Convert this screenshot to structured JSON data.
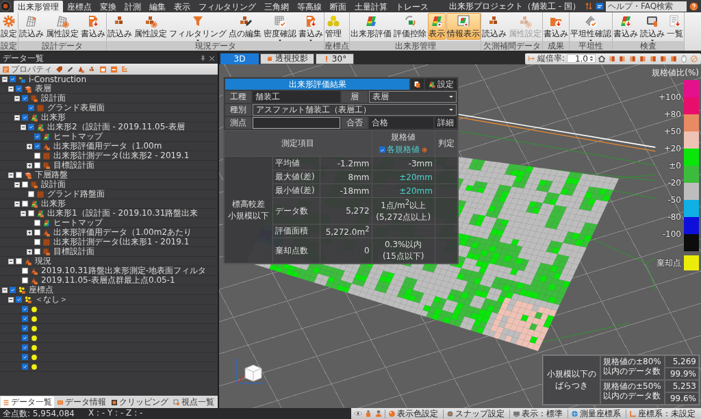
{
  "menu_tabs": [
    {
      "label": "出来形管理",
      "selected": true
    },
    {
      "label": "座標点",
      "selected": false
    },
    {
      "label": "変換",
      "selected": false
    },
    {
      "label": "計測",
      "selected": false
    },
    {
      "label": "編集",
      "selected": false
    },
    {
      "label": "表示",
      "selected": false
    },
    {
      "label": "フィルタリング",
      "selected": false
    },
    {
      "label": "三角網",
      "selected": false
    },
    {
      "label": "等高線",
      "selected": false
    },
    {
      "label": "断面",
      "selected": false
    },
    {
      "label": "土量計算",
      "selected": false
    },
    {
      "label": "トレース",
      "selected": false
    }
  ],
  "project_title": "出来形プロジェクト（舗装工 - 国）",
  "help_search": {
    "placeholder": "ヘルプ・FAQ検索"
  },
  "ribbon_groups": [
    {
      "label": "設定",
      "buttons": [
        {
          "label": "設定",
          "active": false,
          "disabled": false,
          "dropdown": false
        }
      ]
    },
    {
      "label": "設計データ",
      "buttons": [
        {
          "label": "読込み",
          "active": false,
          "disabled": false,
          "dropdown": false
        },
        {
          "label": "属性設定",
          "active": false,
          "disabled": false,
          "dropdown": false
        },
        {
          "label": "書込み",
          "active": false,
          "disabled": false,
          "dropdown": false
        }
      ]
    },
    {
      "label": "現況データ",
      "buttons": [
        {
          "label": "読込み",
          "active": false,
          "disabled": false,
          "dropdown": false
        },
        {
          "label": "属性設定",
          "active": false,
          "disabled": false,
          "dropdown": false
        },
        {
          "label": "フィルタリング",
          "active": false,
          "disabled": false,
          "dropdown": true
        },
        {
          "label": "点の編集",
          "active": false,
          "disabled": false,
          "dropdown": false
        },
        {
          "label": "密度確認",
          "active": false,
          "disabled": false,
          "dropdown": true
        },
        {
          "label": "書込み",
          "active": false,
          "disabled": false,
          "dropdown": true
        }
      ]
    },
    {
      "label": "座標点",
      "buttons": [
        {
          "label": "管理",
          "active": false,
          "disabled": false,
          "dropdown": false
        }
      ]
    },
    {
      "label": "出来形管理",
      "buttons": [
        {
          "label": "出来形評価",
          "active": false,
          "disabled": false,
          "dropdown": false
        },
        {
          "label": "評価控除",
          "active": false,
          "disabled": false,
          "dropdown": false
        },
        {
          "label": "表示",
          "active": true,
          "disabled": false,
          "dropdown": false
        },
        {
          "label": "情報表示",
          "active": true,
          "disabled": false,
          "dropdown": false
        }
      ]
    },
    {
      "label": "欠測補間データ",
      "buttons": [
        {
          "label": "読込み",
          "active": false,
          "disabled": false,
          "dropdown": false
        },
        {
          "label": "属性設定",
          "active": false,
          "disabled": true,
          "dropdown": false
        }
      ]
    },
    {
      "label": "成果",
      "buttons": [
        {
          "label": "書込み",
          "active": false,
          "disabled": false,
          "dropdown": false
        }
      ]
    },
    {
      "label": "平坦性",
      "buttons": [
        {
          "label": "平坦性確認",
          "active": false,
          "disabled": false,
          "dropdown": true
        }
      ]
    },
    {
      "label": "検査",
      "buttons": [
        {
          "label": "書込み",
          "active": false,
          "disabled": false,
          "dropdown": false
        },
        {
          "label": "読込み",
          "active": false,
          "disabled": false,
          "dropdown": true
        },
        {
          "label": "一覧",
          "active": false,
          "disabled": false,
          "dropdown": false
        }
      ]
    }
  ],
  "data_panel": {
    "title": "データ一覧",
    "toolbar_label": "プロパティ",
    "tree": [
      {
        "label": "i-Construction",
        "kind": "project",
        "checked": true,
        "expanded": true,
        "children": [
          {
            "label": "表層",
            "kind": "layer",
            "checked": true,
            "expanded": true,
            "children": [
              {
                "label": "設計面",
                "kind": "design",
                "checked": true,
                "expanded": true,
                "children": [
                  {
                    "label": "グランド表層面",
                    "kind": "surface",
                    "checked": true
                  }
                ]
              },
              {
                "label": "出来形",
                "kind": "finish",
                "checked": true,
                "expanded": true,
                "children": [
                  {
                    "label": "出来形2（設計面 - 2019.11.05-表層",
                    "kind": "finish",
                    "checked": true,
                    "expanded": true,
                    "children": [
                      {
                        "label": "ヒートマップ",
                        "kind": "heatmap",
                        "checked": true
                      },
                      {
                        "label": "出来形評価用データ（1.00m",
                        "kind": "cone",
                        "checked": true,
                        "expanded": false
                      },
                      {
                        "label": "出来形計測データ(出来形2 - 2019.1",
                        "kind": "surface",
                        "checked": false
                      },
                      {
                        "label": "目標設計面",
                        "kind": "design",
                        "checked": false,
                        "expanded": false
                      }
                    ]
                  }
                ]
              }
            ]
          },
          {
            "label": "下層路盤",
            "kind": "layer",
            "checked": false,
            "expanded": true,
            "children": [
              {
                "label": "設計面",
                "kind": "design",
                "checked": false,
                "expanded": true,
                "children": [
                  {
                    "label": "グランド路盤面",
                    "kind": "surface",
                    "checked": false
                  }
                ]
              },
              {
                "label": "出来形",
                "kind": "finish",
                "checked": false,
                "expanded": true,
                "children": [
                  {
                    "label": "出来形1（設計面 - 2019.10.31路盤出来",
                    "kind": "finish",
                    "checked": false,
                    "expanded": true,
                    "children": [
                      {
                        "label": "ヒートマップ",
                        "kind": "heatmap",
                        "checked": false
                      },
                      {
                        "label": "出来形評価用データ（1.00m2あたり",
                        "kind": "cone",
                        "checked": false,
                        "expanded": false
                      },
                      {
                        "label": "出来形計測データ(出来形1 - 2019.1",
                        "kind": "surface",
                        "checked": false
                      },
                      {
                        "label": "目標設計面",
                        "kind": "design",
                        "checked": false,
                        "expanded": false
                      }
                    ]
                  }
                ]
              }
            ]
          },
          {
            "label": "現況",
            "kind": "cone",
            "checked": false,
            "expanded": true,
            "children": [
              {
                "label": "2019.10.31路盤出来形測定-地表面フィルタ",
                "kind": "cone",
                "checked": false
              },
              {
                "label": "2019.11.05-表層点群最上点0.05-1",
                "kind": "cone",
                "checked": false
              }
            ]
          }
        ]
      },
      {
        "label": "座標点",
        "kind": "points",
        "checked": true,
        "expanded": true,
        "children": [
          {
            "label": "＜なし＞",
            "kind": "points",
            "checked": true,
            "expanded": true,
            "children": [
              {
                "kind": "point",
                "checked": true
              },
              {
                "kind": "point",
                "checked": true
              },
              {
                "kind": "point",
                "checked": true
              },
              {
                "kind": "point",
                "checked": true
              },
              {
                "kind": "point",
                "checked": true
              },
              {
                "kind": "point",
                "checked": true
              },
              {
                "kind": "point",
                "checked": true
              }
            ]
          }
        ]
      }
    ],
    "tabs": [
      {
        "label": "データ一覧",
        "selected": true
      },
      {
        "label": "データ情報",
        "selected": false
      },
      {
        "label": "クリッピング",
        "selected": false
      },
      {
        "label": "視点一覧",
        "selected": false
      }
    ]
  },
  "view": {
    "tabs": [
      {
        "label": "3D",
        "selected": true
      },
      {
        "label": "透視投影",
        "selected": false
      },
      {
        "label": "30°",
        "selected": false
      }
    ],
    "scale_label": "縦倍率:",
    "scale_value": "1.0",
    "legend": {
      "title": "規格値比(%)",
      "bands": [
        {
          "color": "#e4108c"
        },
        {
          "label": "+100",
          "color": "#e80f6c"
        },
        {
          "label": "+80",
          "color": "#e88a62"
        },
        {
          "label": "+50",
          "color": "#efc2b6"
        },
        {
          "label": "+20",
          "color": "#0ae60a"
        },
        {
          "label": "±0",
          "color": "#3cbc3c"
        },
        {
          "label": "-20",
          "color": "#bdbdbd"
        },
        {
          "label": "-50",
          "color": "#0eb0e6"
        },
        {
          "label": "-80",
          "color": "#0f0fdc"
        },
        {
          "label": "-100",
          "color": "#0c0c0c"
        }
      ],
      "rejected": {
        "label": "棄却点",
        "color": "#ecec0a"
      }
    },
    "eval_panel": {
      "title": "出来形評価結果",
      "settings_button": "設定",
      "work_type": {
        "label": "工種",
        "value": "舗装工"
      },
      "layer": {
        "label": "層",
        "value": "表層"
      },
      "category": {
        "label": "種別",
        "value": "アスファルト舗装工（表層工）"
      },
      "station": {
        "label": "測点"
      },
      "result": {
        "label": "合否",
        "value": "合格"
      },
      "detail_button": "詳細",
      "columns": [
        "測定項目",
        "規格値",
        "判定"
      ],
      "standard_checkbox": {
        "label": "各規格値",
        "checked": true
      },
      "group_label": [
        "標高較差",
        "小規模以下"
      ],
      "rows": [
        {
          "item": "平均値",
          "measured": "-1.2mm",
          "standard": [
            "-3mm"
          ],
          "highlighted": false
        },
        {
          "item": "最大値(差)",
          "measured": "8mm",
          "standard": [
            "±20mm"
          ],
          "highlighted": true
        },
        {
          "item": "最小値(差)",
          "measured": "-18mm",
          "standard": [
            "±20mm"
          ],
          "highlighted": true
        },
        {
          "item": "データ数",
          "measured": "5,272",
          "standard": [
            "1点/m$^{2}$以上",
            "(5,272点以上)"
          ],
          "highlighted": false
        },
        {
          "item": "評価面積",
          "measured": "5,272.0m$^{2}$"
        },
        {
          "item": "棄却点数",
          "measured": "0",
          "standard": [
            "0.3%以内",
            "(15点以下)"
          ],
          "highlighted": false
        }
      ]
    },
    "summary": {
      "group_label": "小規模以下のばらつき",
      "rows": [
        {
          "label": "規格値の±80%以内のデータ数",
          "count": "5,269",
          "ratio": "99.9%"
        },
        {
          "label": "規格値の±50%以内のデータ数",
          "count": "5,253",
          "ratio": "99.6%"
        }
      ]
    }
  },
  "status_bar": {
    "point_count": "全点数: 5,954,084",
    "coordinates": "X : - Y : - Z : -",
    "items": [
      {
        "label": "表示色設定"
      },
      {
        "label": "スナップ設定"
      },
      {
        "label": "表示：標準"
      },
      {
        "label": "測量座標系"
      },
      {
        "label": "座標系：未設定"
      }
    ]
  }
}
